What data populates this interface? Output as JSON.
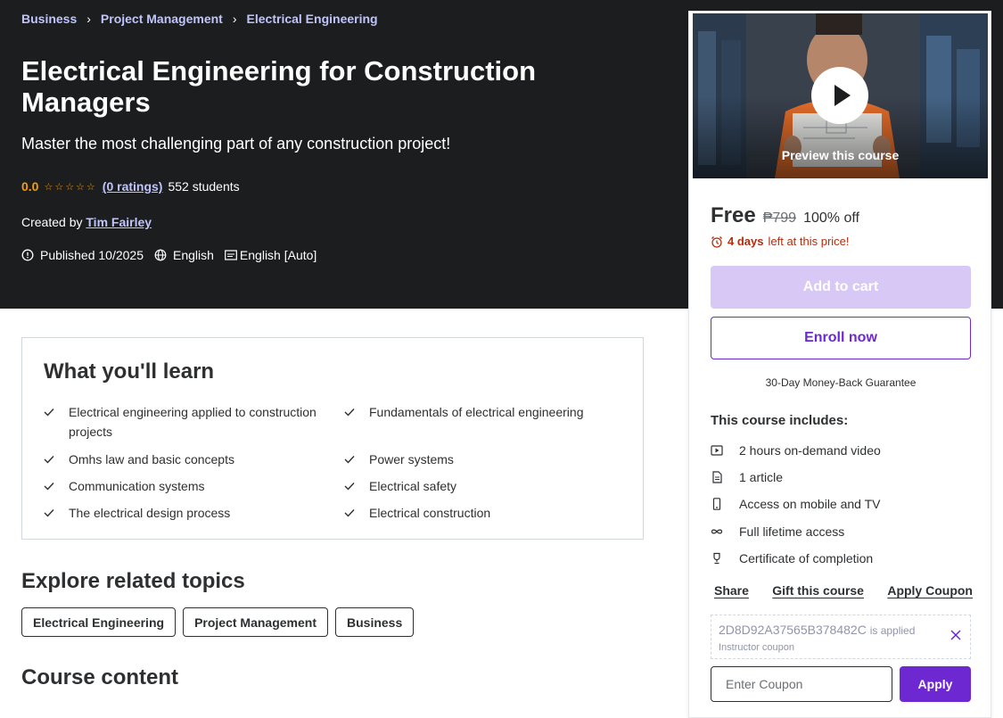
{
  "breadcrumb": [
    "Business",
    "Project Management",
    "Electrical Engineering"
  ],
  "course": {
    "title": "Electrical Engineering for Construction Managers",
    "subtitle": "Master the most challenging part of any construction project!",
    "rating": "0.0",
    "stars": 0,
    "ratings_label": "(0 ratings)",
    "students": "552 students",
    "created_by_label": "Created by",
    "instructor": "Tim Fairley",
    "published": "Published 10/2025",
    "language": "English",
    "captions": "English [Auto]"
  },
  "learn": {
    "title": "What you'll learn",
    "items": [
      "Electrical engineering applied to construction projects",
      "Fundamentals of electrical engineering",
      "Omhs law and basic concepts",
      "Power systems",
      "Communication systems",
      "Electrical safety",
      "The electrical design process",
      "Electrical construction"
    ]
  },
  "related": {
    "title": "Explore related topics",
    "topics": [
      "Electrical Engineering",
      "Project Management",
      "Business"
    ]
  },
  "content": {
    "title": "Course content"
  },
  "sidebar": {
    "preview_label": "Preview this course",
    "price": "Free",
    "old_price": "₱799",
    "discount": "100% off",
    "timer_bold": "4 days",
    "timer_rest": "left at this price!",
    "add_to_cart": "Add to cart",
    "enroll": "Enroll now",
    "guarantee": "30-Day Money-Back Guarantee",
    "includes_title": "This course includes:",
    "includes": [
      {
        "icon": "video-icon",
        "text": "2 hours on-demand video"
      },
      {
        "icon": "article-icon",
        "text": "1 article"
      },
      {
        "icon": "mobile-icon",
        "text": "Access on mobile and TV"
      },
      {
        "icon": "infinity-icon",
        "text": "Full lifetime access"
      },
      {
        "icon": "trophy-icon",
        "text": "Certificate of completion"
      }
    ],
    "share": "Share",
    "gift": "Gift this course",
    "apply_coupon": "Apply Coupon",
    "coupon_code": "2D8D92A37565B378482C",
    "coupon_applied_suffix": "is applied",
    "coupon_type": "Instructor coupon",
    "coupon_placeholder": "Enter Coupon",
    "apply": "Apply"
  },
  "colors": {
    "hero_bg": "#1c1d1f",
    "link": "#c0c4fc",
    "star": "#f69c08",
    "accent": "#6d28d2",
    "urgent": "#b32d0f"
  }
}
